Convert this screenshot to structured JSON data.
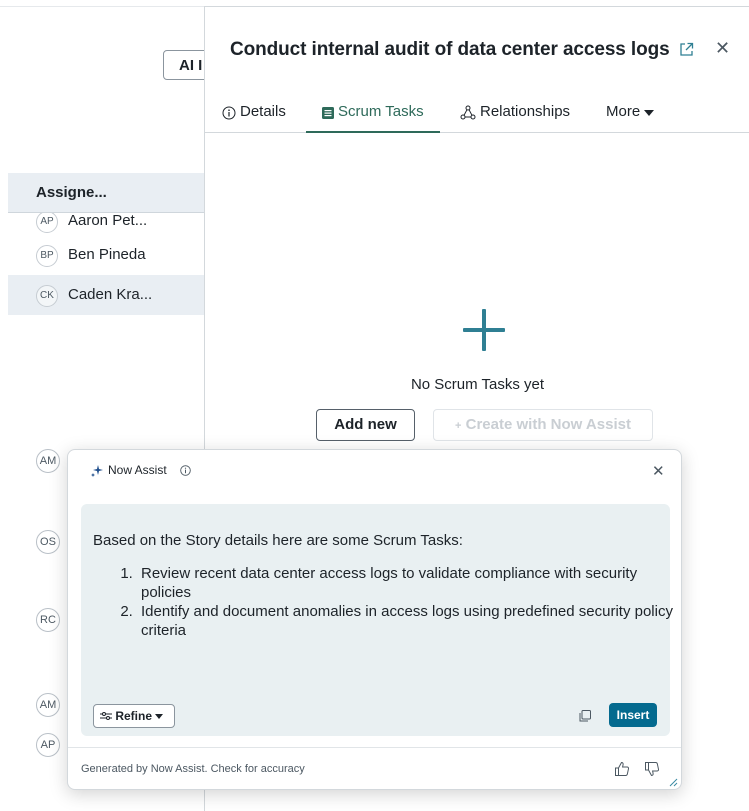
{
  "background": {
    "ai_button_label": "AI I",
    "column_header": "Assigne...",
    "rows": [
      {
        "initials": "AP",
        "name": "Aaron Pet..."
      },
      {
        "initials": "BP",
        "name": "Ben Pineda"
      },
      {
        "initials": "CK",
        "name": "Caden Kra..."
      }
    ],
    "left_avatars": [
      "AM",
      "OS",
      "RC",
      "AM",
      "AP"
    ]
  },
  "panel": {
    "title": "Conduct internal audit of data center access logs",
    "tabs": [
      {
        "label": "Details",
        "icon": "info-icon"
      },
      {
        "label": "Scrum Tasks",
        "icon": "list-icon",
        "active": true
      },
      {
        "label": "Relationships",
        "icon": "relationships-icon"
      },
      {
        "label": "More",
        "icon": "caret-down-icon"
      }
    ],
    "empty_state_text": "No Scrum Tasks yet",
    "add_new_label": "Add new",
    "create_with_assist_label": "Create with Now Assist"
  },
  "now_assist": {
    "title": "Now Assist",
    "intro": "Based on the Story details here are some Scrum Tasks:",
    "tasks": [
      "Review recent data center access logs to validate compliance with security policies",
      "Identify and document anomalies in access logs using predefined security policy criteria"
    ],
    "refine_label": "Refine",
    "insert_label": "Insert",
    "footer_text": "Generated by Now Assist. Check for accuracy"
  },
  "colors": {
    "accent": "#046a8f",
    "tab_active_underline": "#2e6a5a",
    "plus_icon": "#2f7f93",
    "message_bg": "#e9f0f2"
  }
}
